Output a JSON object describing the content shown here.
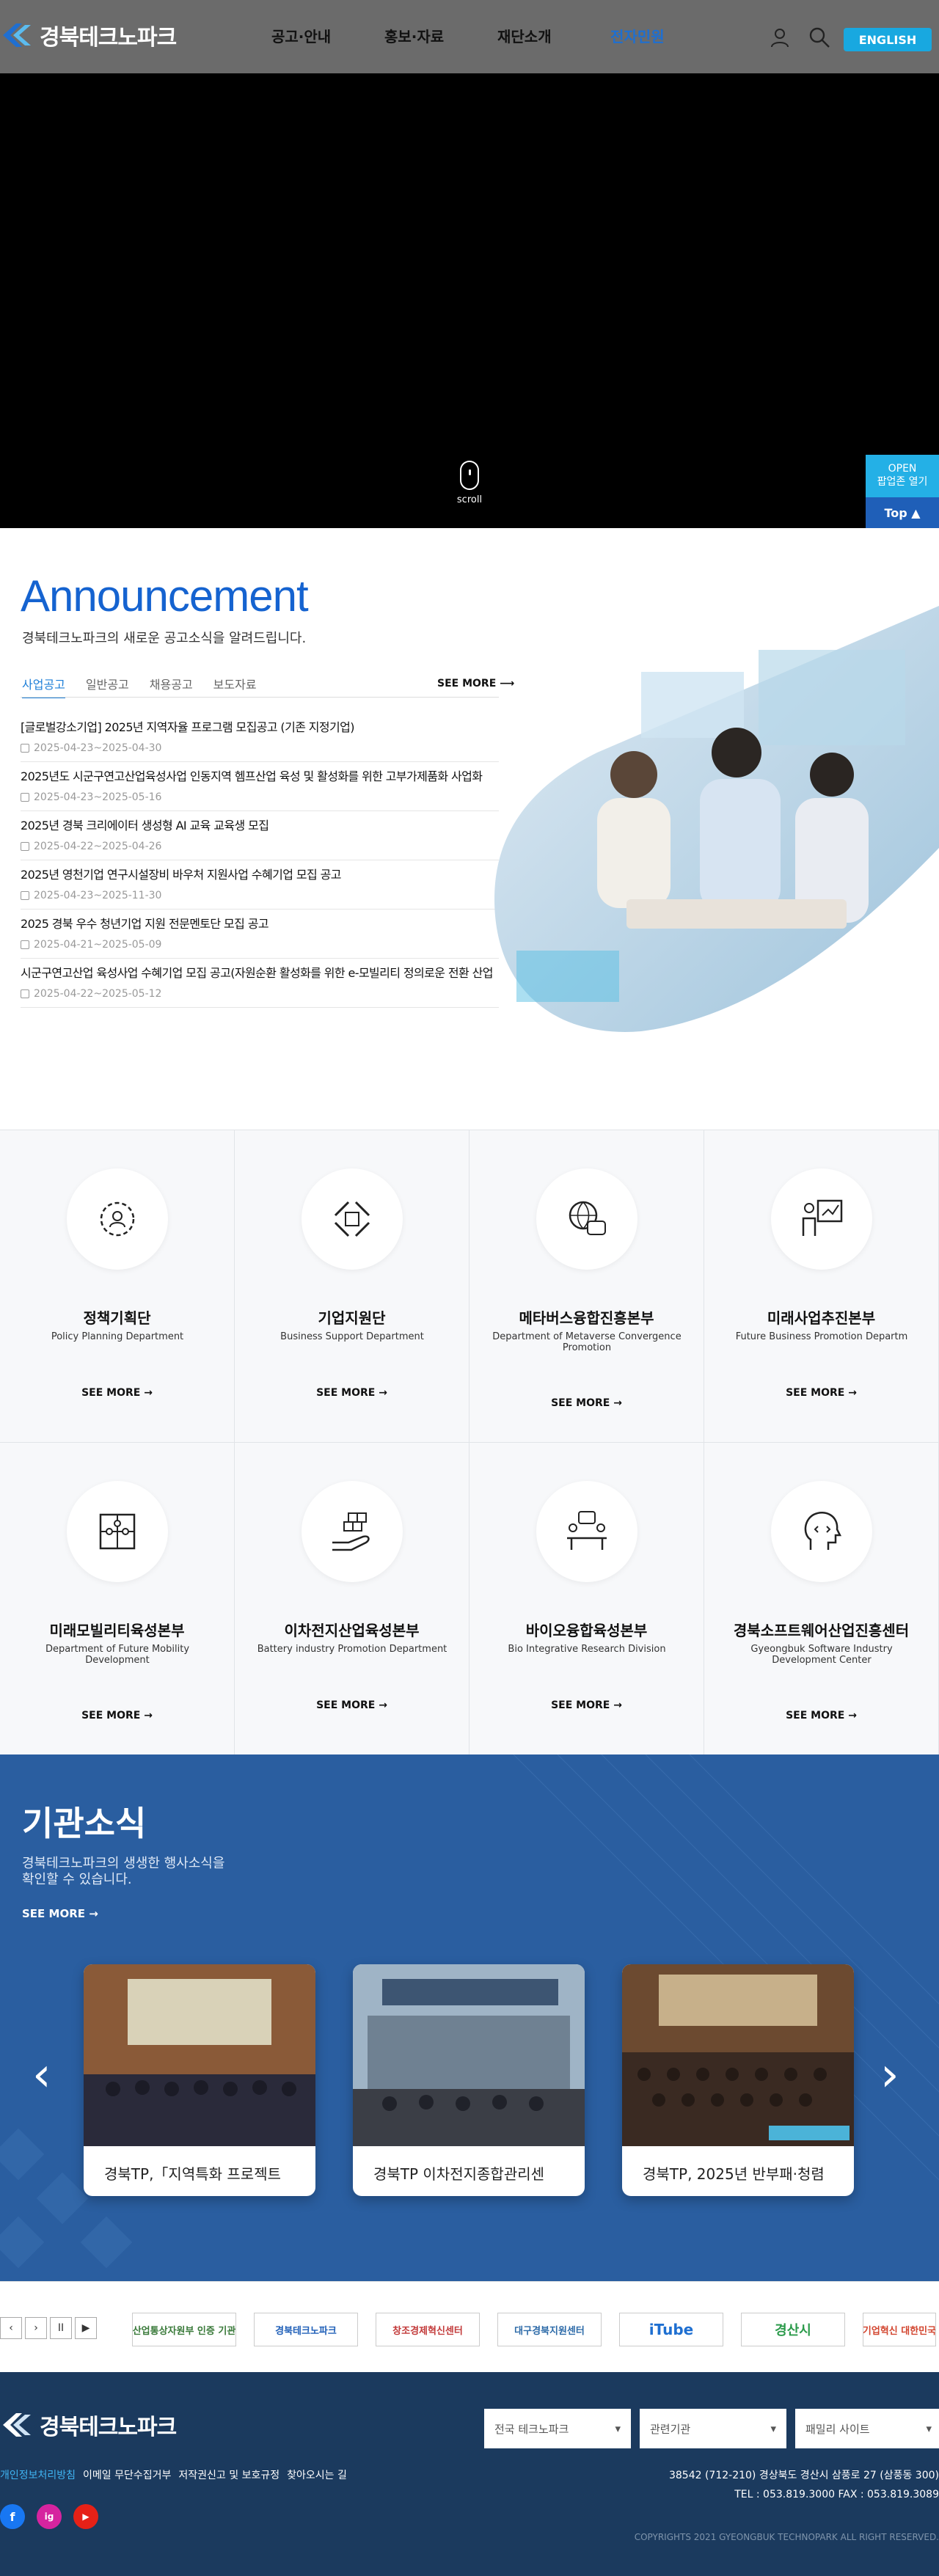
{
  "header": {
    "logo": "경북테크노파크",
    "nav": [
      "공고·안내",
      "홍보·자료",
      "재단소개",
      "전자민원"
    ],
    "english_button": "ENGLISH"
  },
  "hero": {
    "scroll_label": "scroll",
    "popup_open_en": "OPEN",
    "popup_open": "팝업존 열기",
    "top_button": "Top ▲"
  },
  "announcement": {
    "title": "Announcement",
    "subtitle": "경북테크노파크의 새로운 공고소식을 알려드립니다.",
    "tabs": [
      "사업공고",
      "일반공고",
      "채용공고",
      "보도자료"
    ],
    "see_more": "SEE MORE",
    "items": [
      {
        "title": "[글로벌강소기업] 2025년 지역자율 프로그램 모집공고 (기존 지정기업)",
        "date": "2025-04-23~2025-04-30"
      },
      {
        "title": "2025년도 시군구연고산업육성사업 인동지역 헴프산업 육성 및 활성화를 위한 고부가제품화 사업화",
        "date": "2025-04-23~2025-05-16"
      },
      {
        "title": "2025년 경북 크리에이터 생성형 AI 교육 교육생 모집",
        "date": "2025-04-22~2025-04-26"
      },
      {
        "title": "2025년 영천기업 연구시설장비 바우처 지원사업 수혜기업 모집 공고",
        "date": "2025-04-23~2025-11-30"
      },
      {
        "title": "2025 경북 우수 청년기업 지원 전문멘토단 모집 공고",
        "date": "2025-04-21~2025-05-09"
      },
      {
        "title": "시군구연고산업 육성사업 수혜기업 모집 공고(자원순환 활성화를 위한 e-모빌리티 정의로운 전환 산업",
        "date": "2025-04-22~2025-05-12"
      }
    ]
  },
  "departments": {
    "see_more": "SEE MORE",
    "items": [
      {
        "name": "정책기획단",
        "en": "Policy Planning Department",
        "icon": "gear-people-icon"
      },
      {
        "name": "기업지원단",
        "en": "Business Support Department",
        "icon": "hands-cycle-icon"
      },
      {
        "name": "메타버스융합진흥본부",
        "en": "Department of Metaverse Convergence Promotion",
        "icon": "globe-vr-icon"
      },
      {
        "name": "미래사업추진본부",
        "en": "Future Business Promotion Departm",
        "icon": "presenter-chart-icon"
      },
      {
        "name": "미래모빌리티육성본부",
        "en": "Department of Future Mobility Development",
        "icon": "puzzle-icon"
      },
      {
        "name": "이차전지산업육성본부",
        "en": "Battery industry Promotion Department",
        "icon": "hand-blocks-icon"
      },
      {
        "name": "바이오융합육성본부",
        "en": "Bio Integrative Research Division",
        "icon": "meeting-icon"
      },
      {
        "name": "경북소프트웨어산업진흥센터",
        "en": "Gyeongbuk Software Industry Development Center",
        "icon": "head-code-icon"
      }
    ]
  },
  "news": {
    "title": "기관소식",
    "subtitle": "경북테크노파크의 생생한 행사소식을 확인할 수 있습니다.",
    "see_more": "SEE MORE",
    "prev": "‹",
    "next": "›",
    "cards": [
      {
        "title": "경북TP,「지역특화 프로젝트"
      },
      {
        "title": "경북TP 이차전지종합관리센"
      },
      {
        "title": "경북TP, 2025년 반부패·청렴"
      }
    ]
  },
  "banners": {
    "controls": [
      "‹",
      "›",
      "II",
      "▶"
    ],
    "logos": [
      "산업통상자원부 인증 기관",
      "경북테크노파크",
      "창조경제혁신센터",
      "대구경북지원센터",
      "iTube",
      "경산시",
      "기업혁신 대한민국"
    ]
  },
  "footer": {
    "logo": "경북테크노파크",
    "links": [
      "개인정보처리방침",
      "이메일 무단수집거부",
      "저작권신고 및 보호규정",
      "찾아오시는 길"
    ],
    "selects": [
      "전국 테크노파크",
      "관련기관",
      "패밀리 사이트"
    ],
    "address": "38542 (712-210) 경상북도 경산시 삼풍로 27 (삼풍동 300)",
    "tel": "TEL : 053.819.3000   FAX : 053.819.3089",
    "sns": [
      "f",
      "ig",
      "▶"
    ],
    "copyright": "COPYRIGHTS 2021 GYEONGBUK TECHNOPARK ALL RIGHT RESERVED."
  },
  "colors": {
    "brand_blue": "#1563d0",
    "accent_cyan": "#18a8e0",
    "news_bg": "#2a5ea0",
    "footer_bg": "#1b3a5e"
  }
}
